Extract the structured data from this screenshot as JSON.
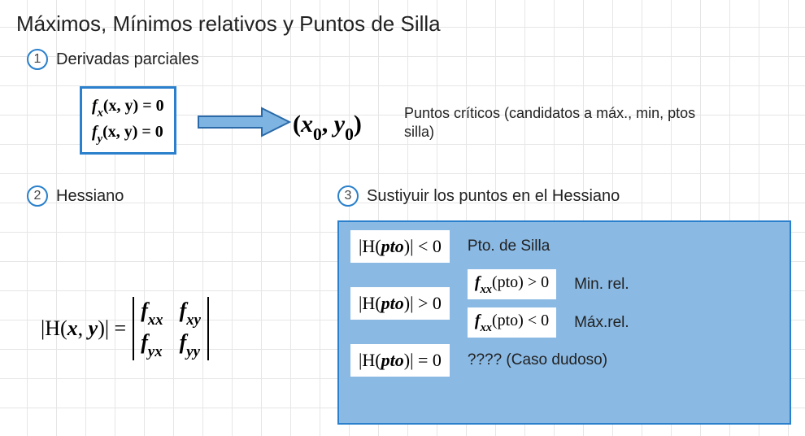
{
  "title": "Máximos, Mínimos relativos y Puntos de Silla",
  "step1": {
    "num": "1",
    "label": "Derivadas parciales",
    "eq1_lhs": "f",
    "eq1_sub": "x",
    "eq1_args": "(x, y)",
    "eq1_rhs": " = 0",
    "eq2_lhs": "f",
    "eq2_sub": "y",
    "eq2_args": "(x, y)",
    "eq2_rhs": " = 0",
    "result_open": "(",
    "result_x": "x",
    "result_x_sub": "0",
    "result_comma": ", ",
    "result_y": "y",
    "result_y_sub": "0",
    "result_close": ")",
    "desc": "Puntos críticos (candidatos a máx., min, ptos silla)"
  },
  "step2": {
    "num": "2",
    "label": "Hessiano",
    "lhs_open": "|H(",
    "lhs_x": "x",
    "lhs_comma": ", ",
    "lhs_y": "y",
    "lhs_close": ")| = ",
    "m11_f": "f",
    "m11_sub": "xx",
    "m12_f": "f",
    "m12_sub": "xy",
    "m21_f": "f",
    "m21_sub": "yx",
    "m22_f": "f",
    "m22_sub": "yy"
  },
  "step3": {
    "num": "3",
    "label": "Sustiyuir los puntos en el Hessiano",
    "case_lt": {
      "H": "|H(",
      "pto": "pto",
      "close": ")| < 0",
      "text": "Pto. de Silla"
    },
    "case_gt": {
      "H": "|H(",
      "pto": "pto",
      "close": ")| > 0",
      "sub_pos": {
        "f": "f",
        "sub": "xx",
        "args": "(pto) > 0",
        "text": "Min. rel."
      },
      "sub_neg": {
        "f": "f",
        "sub": "xx",
        "args": "(pto) < 0",
        "text": "Máx.rel."
      }
    },
    "case_eq": {
      "H": "|H(",
      "pto": "pto",
      "close": ")| = 0",
      "text": "???? (Caso dudoso)"
    }
  },
  "colors": {
    "accent": "#2a80cc",
    "box_fill": "#8ab9e3"
  }
}
